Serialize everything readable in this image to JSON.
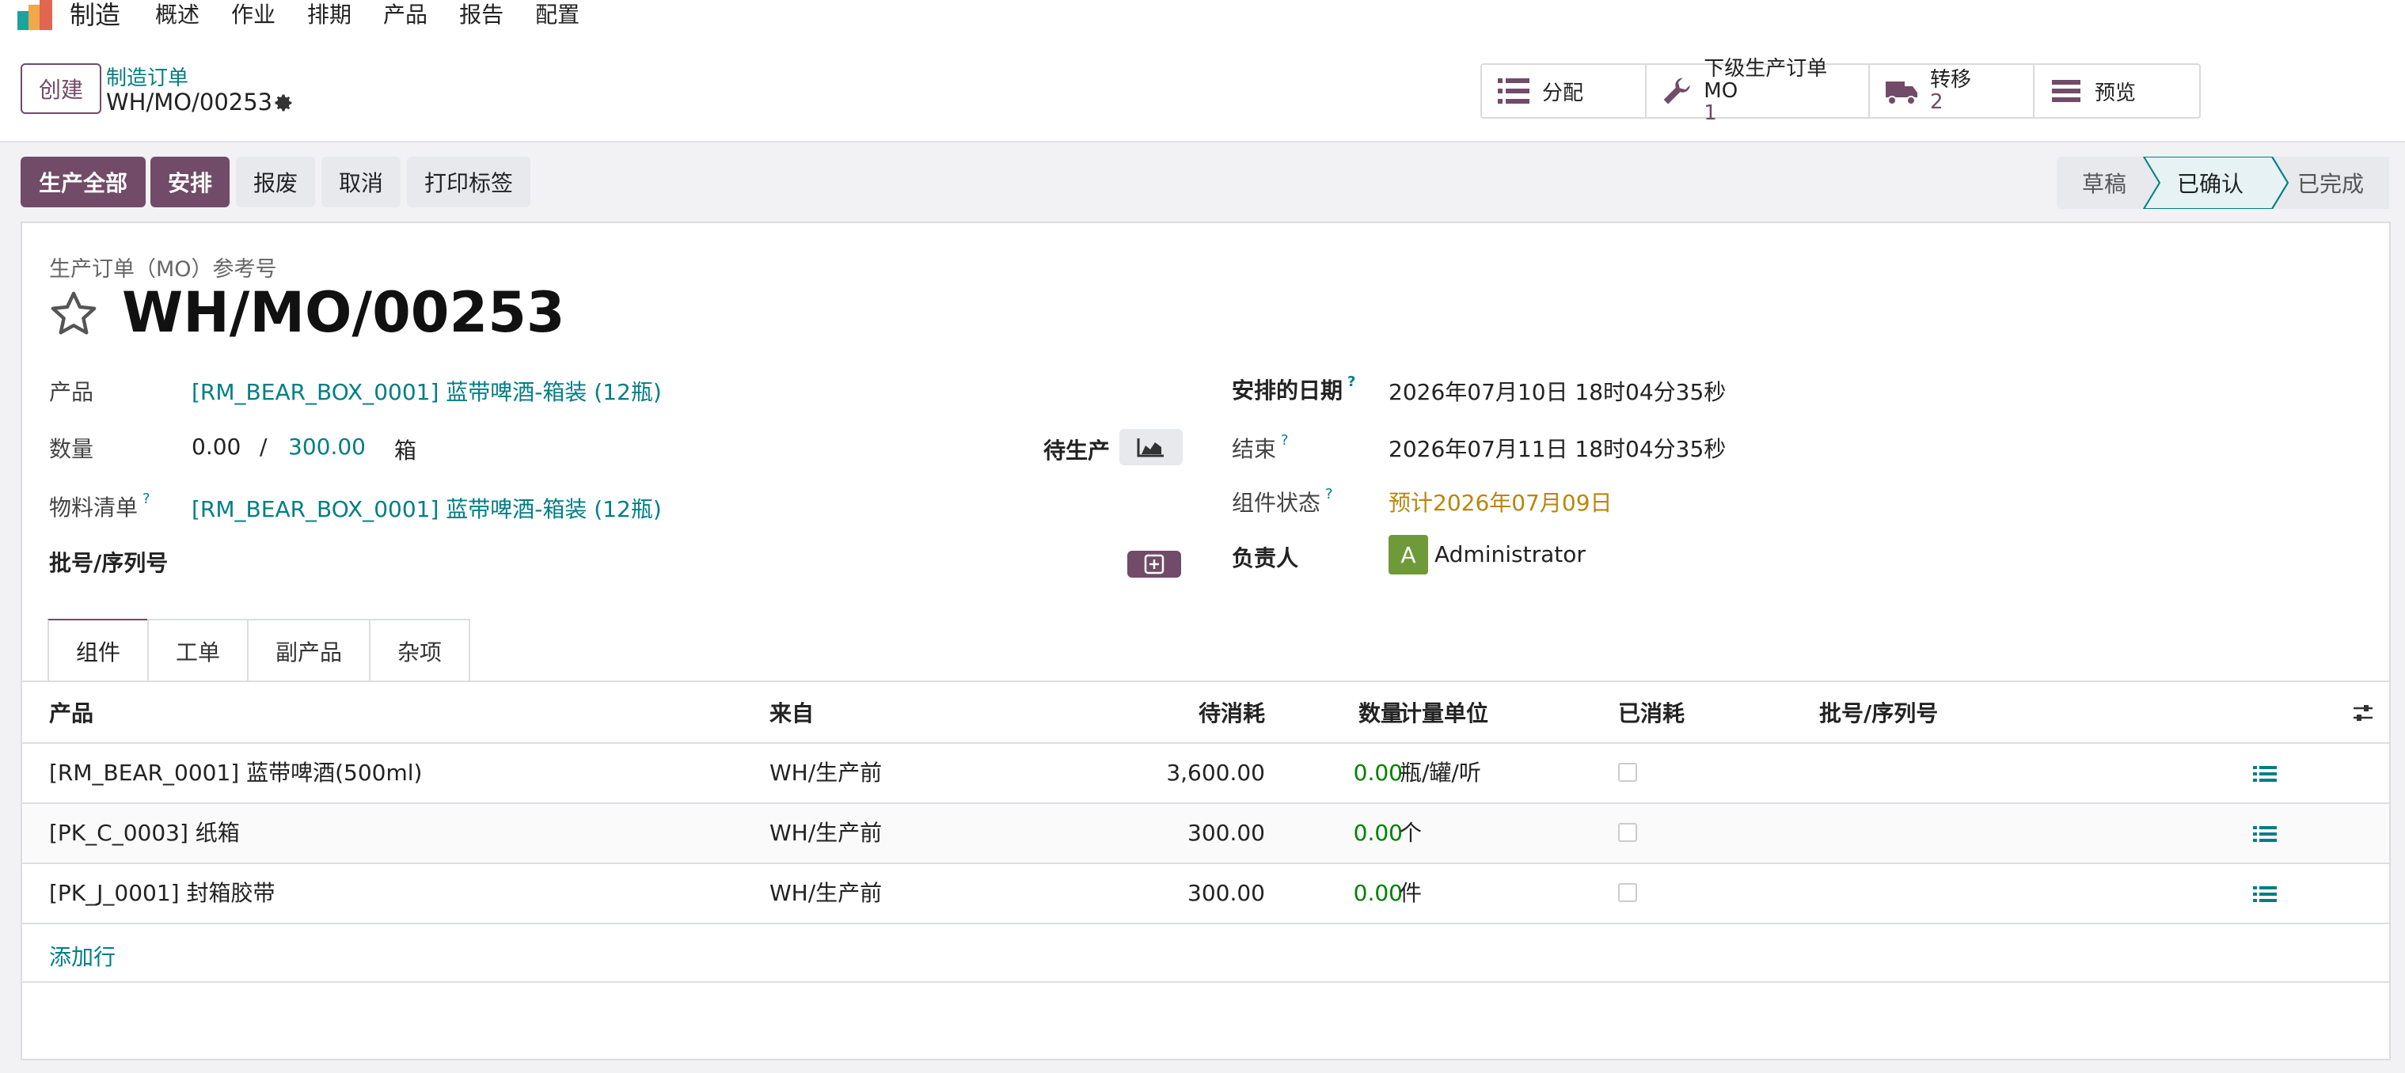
{
  "navbar": {
    "app_name": "制造",
    "menu": [
      "概述",
      "作业",
      "排期",
      "产品",
      "报告",
      "配置"
    ]
  },
  "control_panel": {
    "create_label": "创建",
    "breadcrumb_parent": "制造订单",
    "breadcrumb_current": "WH/MO/00253",
    "stats": [
      {
        "icon": "list-icon",
        "label": "分配"
      },
      {
        "icon": "wrench-icon",
        "label": "下级生产订单 MO",
        "count": "1"
      },
      {
        "icon": "truck-icon",
        "label": "转移",
        "count": "2"
      },
      {
        "icon": "bars-icon",
        "label": "预览"
      }
    ]
  },
  "actions": {
    "produce_all": "生产全部",
    "plan": "安排",
    "scrap": "报废",
    "cancel": "取消",
    "print_labels": "打印标签"
  },
  "status": {
    "draft": "草稿",
    "confirmed": "已确认",
    "done": "已完成",
    "current": "已确认"
  },
  "form": {
    "ref_label": "生产订单（MO）参考号",
    "name": "WH/MO/00253",
    "product_label": "产品",
    "product_value": "[RM_BEAR_BOX_0001] 蓝带啤酒-箱装 (12瓶)",
    "qty_label": "数量",
    "qty_produced": "0.00",
    "qty_sep": "/",
    "qty_total": "300.00",
    "qty_uom": "箱",
    "to_produce_label": "待生产",
    "bom_label": "物料清单",
    "bom_value": "[RM_BEAR_BOX_0001] 蓝带啤酒-箱装 (12瓶)",
    "lot_label": "批号/序列号",
    "scheduled_label": "安排的日期",
    "scheduled_value": "2026年07月10日 18时04分35秒",
    "end_label": "结束",
    "end_value": "2026年07月11日 18时04分35秒",
    "component_status_label": "组件状态",
    "component_status_value": "预计2026年07月09日",
    "responsible_label": "负责人",
    "responsible_initial": "A",
    "responsible_value": "Administrator",
    "help_mark": "?"
  },
  "tabs": [
    "组件",
    "工单",
    "副产品",
    "杂项"
  ],
  "table": {
    "headers": {
      "product": "产品",
      "from": "来自",
      "to_consume": "待消耗",
      "quantity": "数量",
      "uom": "计量单位",
      "consumed": "已消耗",
      "lot": "批号/序列号"
    },
    "rows": [
      {
        "product": "[RM_BEAR_0001] 蓝带啤酒(500ml)",
        "from": "WH/生产前",
        "to_consume": "3,600.00",
        "quantity": "0.00",
        "uom": "瓶/罐/听"
      },
      {
        "product": "[PK_C_0003] 纸箱",
        "from": "WH/生产前",
        "to_consume": "300.00",
        "quantity": "0.00",
        "uom": "个"
      },
      {
        "product": "[PK_J_0001] 封箱胶带",
        "from": "WH/生产前",
        "to_consume": "300.00",
        "quantity": "0.00",
        "uom": "件"
      }
    ],
    "add_line": "添加行"
  },
  "colors": {
    "brand": "#714b67",
    "link": "#017e84",
    "warning": "#b8860b",
    "success": "#008000",
    "avatar": "#6f9a3a"
  }
}
